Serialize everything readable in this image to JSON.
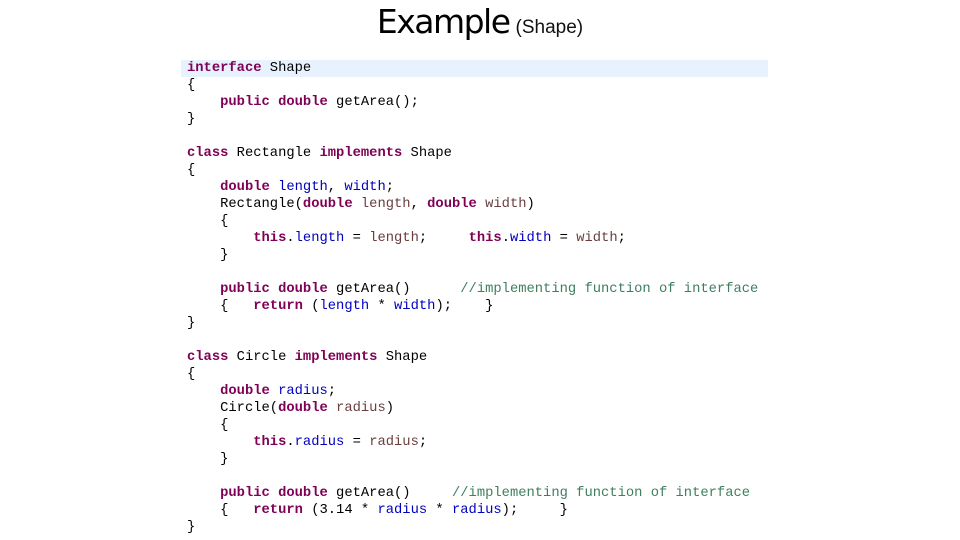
{
  "slide": {
    "title": "Example",
    "subtitle": "(Shape)"
  },
  "code": {
    "language": "java",
    "colors": {
      "keyword": "#7f0055",
      "field": "#0000c0",
      "parameter": "#6a3e3e",
      "comment": "#3f7f5f",
      "current_line_highlight": "#e8f2fe"
    },
    "lines": [
      [
        [
          "kw",
          "interface"
        ],
        [
          "plain",
          " Shape"
        ]
      ],
      [
        [
          "plain",
          "{"
        ]
      ],
      [
        [
          "plain",
          "    "
        ],
        [
          "kw",
          "public"
        ],
        [
          "plain",
          " "
        ],
        [
          "kw",
          "double"
        ],
        [
          "plain",
          " getArea();"
        ]
      ],
      [
        [
          "plain",
          "}"
        ]
      ],
      [],
      [
        [
          "kw",
          "class"
        ],
        [
          "plain",
          " Rectangle "
        ],
        [
          "kw",
          "implements"
        ],
        [
          "plain",
          " Shape"
        ]
      ],
      [
        [
          "plain",
          "{"
        ]
      ],
      [
        [
          "plain",
          "    "
        ],
        [
          "kw",
          "double"
        ],
        [
          "plain",
          " "
        ],
        [
          "fld",
          "length"
        ],
        [
          "plain",
          ", "
        ],
        [
          "fld",
          "width"
        ],
        [
          "plain",
          ";"
        ]
      ],
      [
        [
          "plain",
          "    Rectangle("
        ],
        [
          "kw",
          "double"
        ],
        [
          "plain",
          " "
        ],
        [
          "prm",
          "length"
        ],
        [
          "plain",
          ", "
        ],
        [
          "kw",
          "double"
        ],
        [
          "plain",
          " "
        ],
        [
          "prm",
          "width"
        ],
        [
          "plain",
          ")"
        ]
      ],
      [
        [
          "plain",
          "    {"
        ]
      ],
      [
        [
          "plain",
          "        "
        ],
        [
          "kw",
          "this"
        ],
        [
          "plain",
          "."
        ],
        [
          "fld",
          "length"
        ],
        [
          "plain",
          " = "
        ],
        [
          "prm",
          "length"
        ],
        [
          "plain",
          ";     "
        ],
        [
          "kw",
          "this"
        ],
        [
          "plain",
          "."
        ],
        [
          "fld",
          "width"
        ],
        [
          "plain",
          " = "
        ],
        [
          "prm",
          "width"
        ],
        [
          "plain",
          ";"
        ]
      ],
      [
        [
          "plain",
          "    }"
        ]
      ],
      [],
      [
        [
          "plain",
          "    "
        ],
        [
          "kw",
          "public"
        ],
        [
          "plain",
          " "
        ],
        [
          "kw",
          "double"
        ],
        [
          "plain",
          " getArea()      "
        ],
        [
          "cmt",
          "//implementing function of interface"
        ]
      ],
      [
        [
          "plain",
          "    {   "
        ],
        [
          "kw",
          "return"
        ],
        [
          "plain",
          " ("
        ],
        [
          "fld",
          "length"
        ],
        [
          "plain",
          " * "
        ],
        [
          "fld",
          "width"
        ],
        [
          "plain",
          ");    }"
        ]
      ],
      [
        [
          "plain",
          "}"
        ]
      ],
      [],
      [
        [
          "kw",
          "class"
        ],
        [
          "plain",
          " Circle "
        ],
        [
          "kw",
          "implements"
        ],
        [
          "plain",
          " Shape"
        ]
      ],
      [
        [
          "plain",
          "{"
        ]
      ],
      [
        [
          "plain",
          "    "
        ],
        [
          "kw",
          "double"
        ],
        [
          "plain",
          " "
        ],
        [
          "fld",
          "radius"
        ],
        [
          "plain",
          ";"
        ]
      ],
      [
        [
          "plain",
          "    Circle("
        ],
        [
          "kw",
          "double"
        ],
        [
          "plain",
          " "
        ],
        [
          "prm",
          "radius"
        ],
        [
          "plain",
          ")"
        ]
      ],
      [
        [
          "plain",
          "    {"
        ]
      ],
      [
        [
          "plain",
          "        "
        ],
        [
          "kw",
          "this"
        ],
        [
          "plain",
          "."
        ],
        [
          "fld",
          "radius"
        ],
        [
          "plain",
          " = "
        ],
        [
          "prm",
          "radius"
        ],
        [
          "plain",
          ";"
        ]
      ],
      [
        [
          "plain",
          "    }"
        ]
      ],
      [],
      [
        [
          "plain",
          "    "
        ],
        [
          "kw",
          "public"
        ],
        [
          "plain",
          " "
        ],
        [
          "kw",
          "double"
        ],
        [
          "plain",
          " getArea()     "
        ],
        [
          "cmt",
          "//implementing function of interface"
        ]
      ],
      [
        [
          "plain",
          "    {   "
        ],
        [
          "kw",
          "return"
        ],
        [
          "plain",
          " (3.14 * "
        ],
        [
          "fld",
          "radius"
        ],
        [
          "plain",
          " * "
        ],
        [
          "fld",
          "radius"
        ],
        [
          "plain",
          ");     }"
        ]
      ],
      [
        [
          "plain",
          "}"
        ]
      ]
    ]
  }
}
